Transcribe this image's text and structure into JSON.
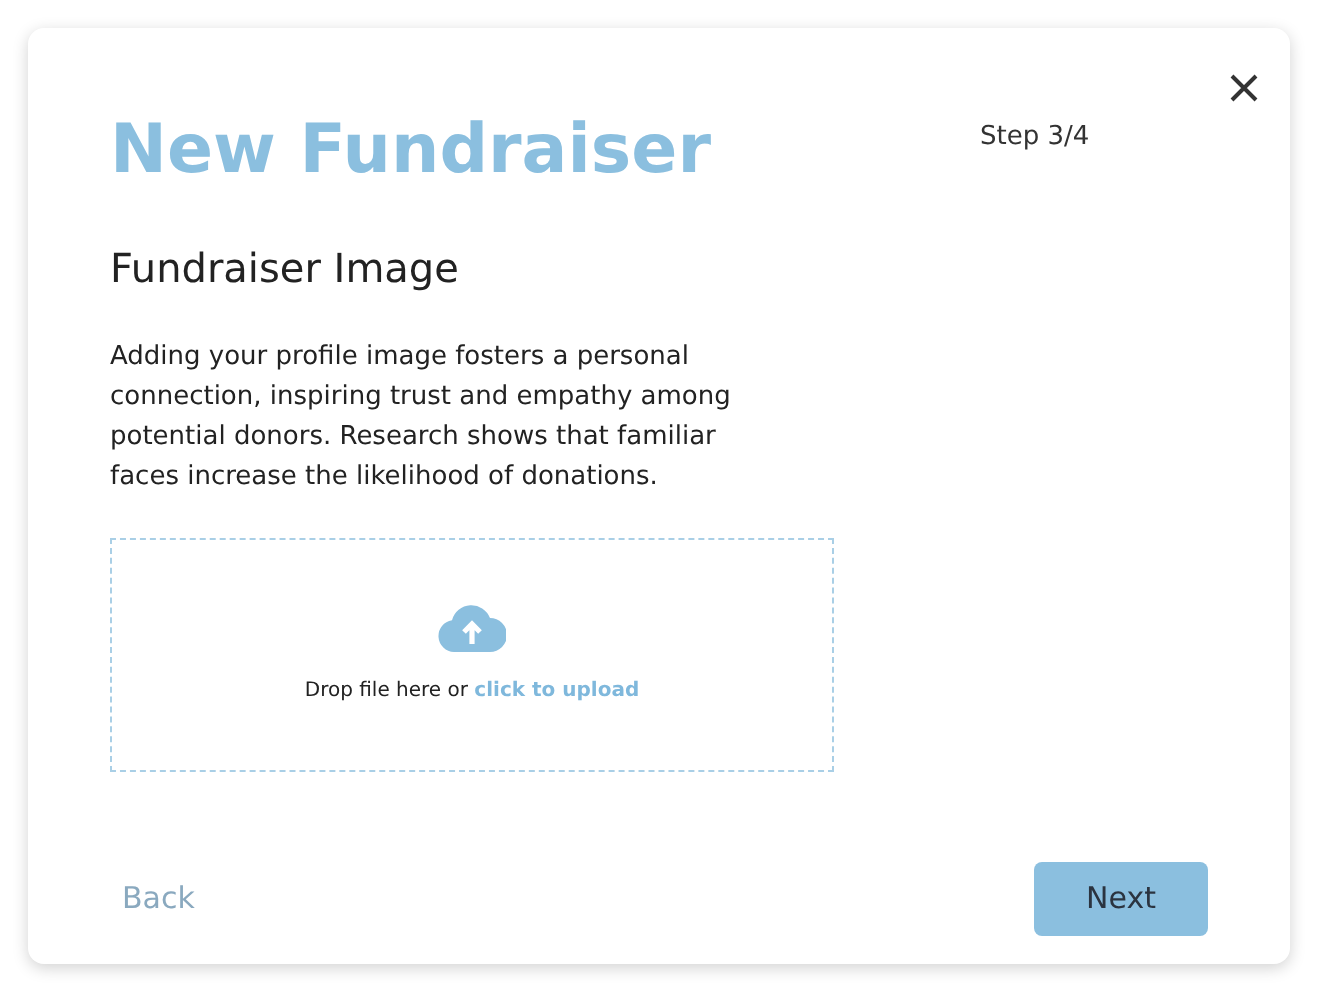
{
  "dialog": {
    "title": "New Fundraiser",
    "step": "Step 3/4"
  },
  "section": {
    "heading": "Fundraiser Image",
    "description": "Adding your profile image fosters a personal connection, inspiring trust and empathy among potential donors. Research shows that familiar faces increase the likelihood of donations."
  },
  "upload": {
    "prompt": "Drop file here or",
    "link": "click to upload"
  },
  "buttons": [
    {
      "label": "Back",
      "kind": "text"
    },
    {
      "label": "Next",
      "kind": "primary"
    }
  ]
}
